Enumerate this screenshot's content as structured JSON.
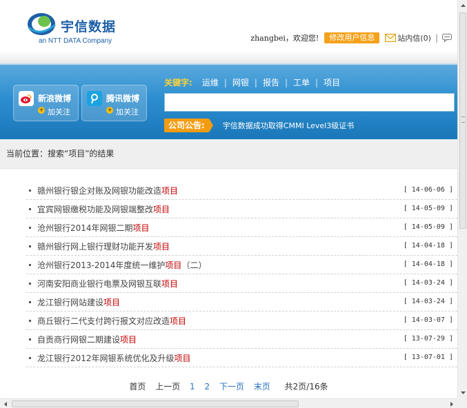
{
  "header": {
    "brand": "宇信数据",
    "subtitle": "an NTT DATA Company",
    "greeting": "zhangbei，欢迎您!",
    "edit_profile": "修改用户信息",
    "inbox": "站内信(0)",
    "separator": "|"
  },
  "social": [
    {
      "name": "新浪微博",
      "follow": "加关注",
      "icon": "sina-weibo-icon"
    },
    {
      "name": "腾讯微博",
      "follow": "加关注",
      "icon": "tencent-weibo-icon"
    }
  ],
  "keywords": {
    "label": "关键字:",
    "items": [
      "运维",
      "网银",
      "报告",
      "工单",
      "项目"
    ]
  },
  "search": {
    "value": "",
    "placeholder": ""
  },
  "notice": {
    "label": "公司公告:",
    "text": "宇信数据成功取得CMMI Level3级证书"
  },
  "breadcrumb": "当前位置：搜索“项目”的结果",
  "results": [
    {
      "prefix": "赣州银行银企对账及网银功能改造",
      "highlight": "项目",
      "suffix": "",
      "date": "[ 14-06-06 ]"
    },
    {
      "prefix": "宜宾网银缴税功能及网银端整改",
      "highlight": "项目",
      "suffix": "",
      "date": "[ 14-05-09 ]"
    },
    {
      "prefix": "沧州银行2014年网银二期",
      "highlight": "项目",
      "suffix": "",
      "date": "[ 14-05-09 ]"
    },
    {
      "prefix": "赣州银行网上银行理财功能开发",
      "highlight": "项目",
      "suffix": "",
      "date": "[ 14-04-18 ]"
    },
    {
      "prefix": "沧州银行2013-2014年度统一维护",
      "highlight": "项目",
      "suffix": "（二）",
      "date": "[ 14-04-18 ]"
    },
    {
      "prefix": "河南安阳商业银行电票及网银互联",
      "highlight": "项目",
      "suffix": "",
      "date": "[ 14-03-24 ]"
    },
    {
      "prefix": "龙江银行网站建设",
      "highlight": "项目",
      "suffix": "",
      "date": "[ 14-03-24 ]"
    },
    {
      "prefix": "商丘银行二代支付跨行报文对应改造",
      "highlight": "项目",
      "suffix": "",
      "date": "[ 14-03-07 ]"
    },
    {
      "prefix": "自贡商行网银二期建设",
      "highlight": "项目",
      "suffix": "",
      "date": "[ 13-07-29 ]"
    },
    {
      "prefix": "龙江银行2012年网银系统优化及升级",
      "highlight": "项目",
      "suffix": "",
      "date": "[ 13-07-01 ]"
    }
  ],
  "pager": {
    "first": "首页",
    "prev": "上一页",
    "pages": [
      "1",
      "2"
    ],
    "next": "下一页",
    "last": "末页",
    "total": "共2页/16条"
  },
  "colors": {
    "band": "#2d8ecf",
    "accent_orange": "#f39c12",
    "highlight_red": "#c00000",
    "link_blue": "#2a72c2"
  }
}
